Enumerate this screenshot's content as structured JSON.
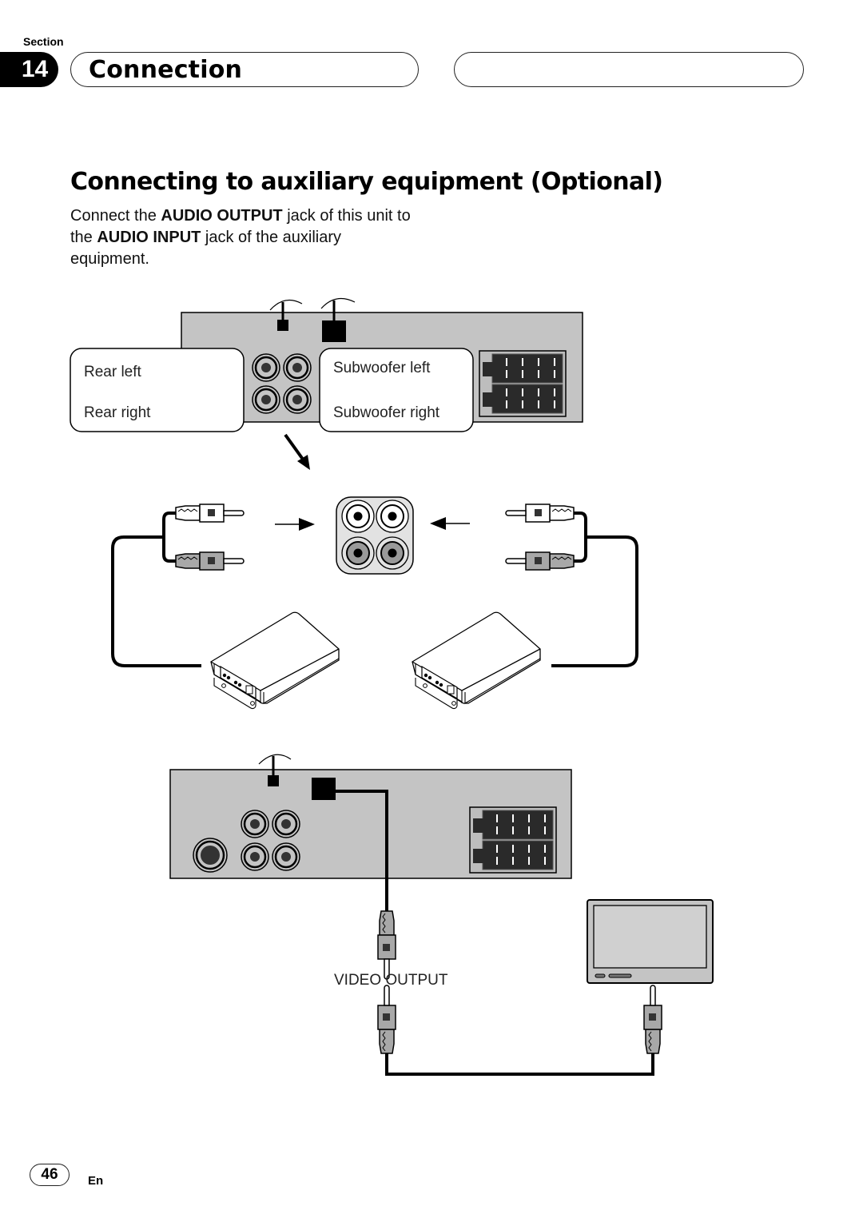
{
  "header": {
    "section_label": "Section",
    "section_number": "14",
    "section_title": "Connection"
  },
  "content": {
    "heading": "Connecting to auxiliary equipment (Optional)",
    "paragraph": [
      {
        "text": "Connect the ",
        "bold": false
      },
      {
        "text": "AUDIO OUTPUT",
        "bold": true
      },
      {
        "text": " jack of this unit to the ",
        "bold": false
      },
      {
        "text": "AUDIO INPUT",
        "bold": true
      },
      {
        "text": " jack of the auxiliary equipment.",
        "bold": false
      }
    ]
  },
  "diagram": {
    "labels": {
      "rear_left": "Rear left",
      "rear_right": "Rear right",
      "subwoofer_left": "Subwoofer left",
      "subwoofer_right": "Subwoofer  right",
      "video_output": "VIDEO OUTPUT"
    },
    "colors": {
      "panel": "#c4c4c4",
      "ink": "#000000",
      "connector_dark": "#2a2a2a",
      "plug_grey": "#a8a8a8",
      "screen": "#cccccc"
    }
  },
  "footer": {
    "page_number": "46",
    "language": "En"
  }
}
